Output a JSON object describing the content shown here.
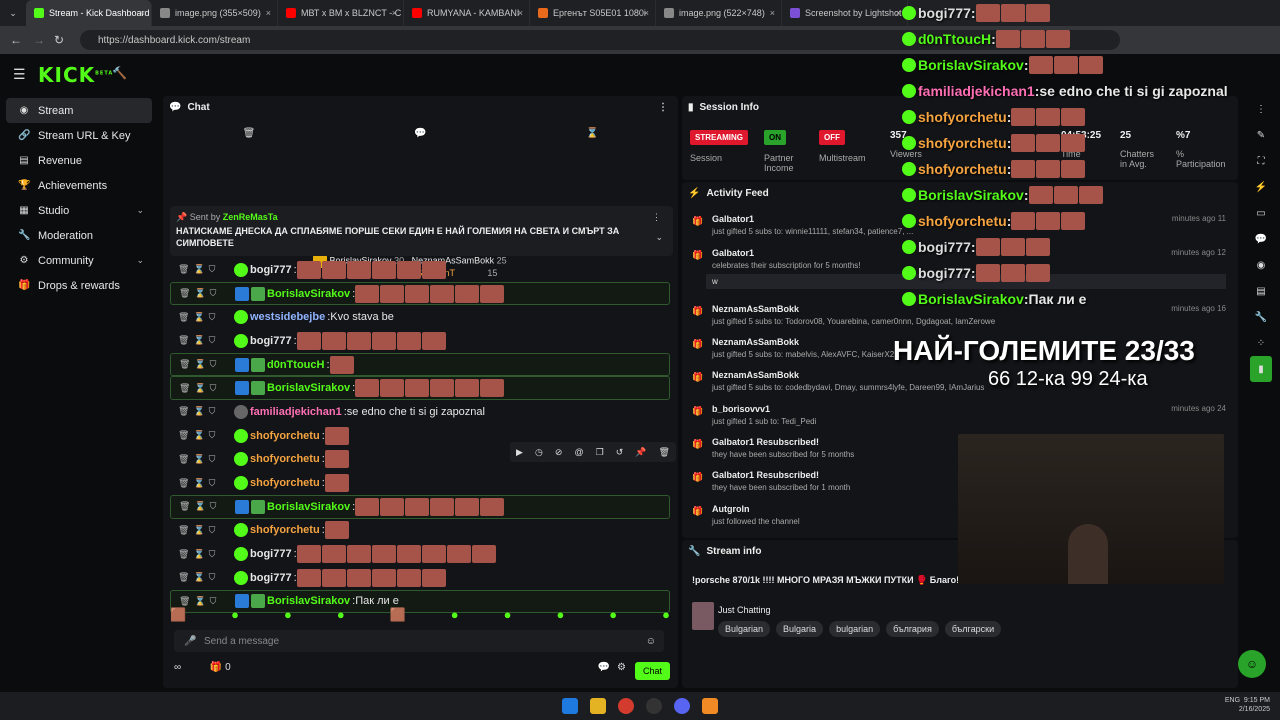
{
  "browser": {
    "tabs": [
      {
        "title": "Stream - Kick Dashboard",
        "color": "#53fc18",
        "active": true
      },
      {
        "title": "image.png (355×509)",
        "color": "#888"
      },
      {
        "title": "МВТ х ВМ х BLZNCT - С",
        "color": "#ff0000"
      },
      {
        "title": "RUMYANA - KAMBANI",
        "color": "#ff0000"
      },
      {
        "title": "Ергенът S05E01 1080i",
        "color": "#e86a1a"
      },
      {
        "title": "image.png (522×748)",
        "color": "#888"
      },
      {
        "title": "Screenshot by Lightshot",
        "color": "#7b4fd6"
      }
    ],
    "url": "https://dashboard.kick.com/stream"
  },
  "brand": {
    "logo": "KICK",
    "beta": "BETA"
  },
  "sidebar": {
    "items": [
      {
        "label": "Stream",
        "icon": "stream-icon",
        "active": true
      },
      {
        "label": "Stream URL & Key",
        "icon": "link-icon"
      },
      {
        "label": "Revenue",
        "icon": "revenue-icon"
      },
      {
        "label": "Achievements",
        "icon": "trophy-icon"
      },
      {
        "label": "Studio",
        "icon": "studio-icon",
        "chevron": true
      },
      {
        "label": "Moderation",
        "icon": "wrench-icon"
      },
      {
        "label": "Community",
        "icon": "community-icon",
        "chevron": true
      },
      {
        "label": "Drops & rewards",
        "icon": "gift-icon"
      }
    ]
  },
  "chat": {
    "title": "Chat",
    "top_gifters": {
      "first": "BorislavSirakov",
      "first_count": "30",
      "second": "NeznamAsSamBokk",
      "second_count": "25",
      "third": "InGentTenT",
      "third_count": "15"
    },
    "pinned": {
      "label": "Sent by",
      "user": "ZenReMasTa",
      "text": "НАТИСКАМЕ ДНЕСКА ДА СПЛАБЯМЕ ПОРШЕ СЕКИ ЕДИН Е НАЙ ГОЛЕМИЯ НА СВЕТА И СМЪРТ ЗА СИМПОВЕТЕ"
    },
    "messages": [
      {
        "user": "bogi777",
        "color": "#e6e6e6",
        "text": "",
        "emotes": 6,
        "hl": false
      },
      {
        "user": "BorislavSirakov",
        "color": "#53fc18",
        "text": "",
        "emotes": 6,
        "hl": true
      },
      {
        "user": "westsidebejbe",
        "color": "#8fb3ff",
        "text": "Kvo stava be",
        "emotes": 0,
        "hl": false
      },
      {
        "user": "bogi777",
        "color": "#e6e6e6",
        "text": "",
        "emotes": 6,
        "hl": false
      },
      {
        "user": "d0nTtoucH",
        "color": "#53fc18",
        "text": "",
        "emotes": 1,
        "hl": true
      },
      {
        "user": "BorislavSirakov",
        "color": "#53fc18",
        "text": "",
        "emotes": 6,
        "hl": true
      },
      {
        "user": "familiadjekichan1",
        "color": "#ff6fb5",
        "text": "se edno che ti si gi zapoznal",
        "emotes": 0,
        "hl": false
      },
      {
        "user": "shofyorchetu",
        "color": "#f4a340",
        "text": "",
        "emotes": 1,
        "hl": false
      },
      {
        "user": "shofyorchetu",
        "color": "#f4a340",
        "text": "",
        "emotes": 1,
        "hl": false
      },
      {
        "user": "shofyorchetu",
        "color": "#f4a340",
        "text": "",
        "emotes": 1,
        "hl": false
      },
      {
        "user": "BorislavSirakov",
        "color": "#53fc18",
        "text": "",
        "emotes": 6,
        "hl": true
      },
      {
        "user": "shofyorchetu",
        "color": "#f4a340",
        "text": "",
        "emotes": 1,
        "hl": false
      },
      {
        "user": "bogi777",
        "color": "#e6e6e6",
        "text": "",
        "emotes": 8,
        "hl": false
      },
      {
        "user": "bogi777",
        "color": "#e6e6e6",
        "text": "",
        "emotes": 6,
        "hl": false
      },
      {
        "user": "BorislavSirakov",
        "color": "#53fc18",
        "text": "Пак ли е",
        "emotes": 0,
        "hl": true
      }
    ],
    "placeholder": "Send a message",
    "count": "0",
    "send_label": "Chat"
  },
  "session": {
    "title": "Session Info",
    "streaming": "STREAMING",
    "on": "ON",
    "off": "OFF",
    "labels": {
      "session": "Session",
      "partner": "Partner Income",
      "multistream": "Multistream",
      "viewers": "Viewers",
      "time": "Time Live",
      "chatters": "Chatters in Avg.",
      "participation": "% Participation"
    },
    "values": {
      "viewers": "357",
      "time": "04:53:25",
      "chatters": "25",
      "participation": "%7"
    }
  },
  "activity": {
    "title": "Activity Feed",
    "items": [
      {
        "who": "Galbator1",
        "det": "just gifted 5 subs to: winnie11111, stefan34, patience7, ...",
        "time": "11 minutes ago"
      },
      {
        "who": "Galbator1",
        "det": "celebrates their subscription for 5 months!",
        "time": "12 minutes ago",
        "note": "w"
      },
      {
        "who": "NeznamAsSamBokk",
        "det": "just gifted 5 subs to: Todorov08, Youarebina, camer0nnn, Dgdagoat, IamZerowe",
        "time": "16 minutes ago"
      },
      {
        "who": "NeznamAsSamBokk",
        "det": "just gifted 5 subs to: mabelvis, AlexAVFC, KaiserX2...",
        "time": ""
      },
      {
        "who": "NeznamAsSamBokk",
        "det": "just gifted 5 subs to: codedbydavi, Dmay, summrs4lyfe, Dareen99, IAmJarius",
        "time": ""
      },
      {
        "who": "b_borisovvv1",
        "det": "just gifted 1 sub to: Tedi_Pedi",
        "time": "24 minutes ago"
      },
      {
        "who": "Galbator1 Resubscribed!",
        "det": "they have been subscribed for 5 months",
        "time": ""
      },
      {
        "who": "Galbator1 Resubscribed!",
        "det": "they have been subscribed for 1 month",
        "time": ""
      },
      {
        "who": "Autgroln",
        "det": "just followed the channel",
        "time": ""
      }
    ]
  },
  "stream_info": {
    "title": "Stream info",
    "stream_title": "!porsche 870/1k !!!! МНОГО МРАЗЯ МЪЖКИ ПУТКИ 🥊 Благо!",
    "category": "Just Chatting",
    "tags": [
      "Bulgarian",
      "Bulgaria",
      "bulgarian",
      "българия",
      "български"
    ]
  },
  "overlay": {
    "lines": [
      {
        "user": "bogi777",
        "text": ""
      },
      {
        "user": "d0nTtoucH",
        "text": ""
      },
      {
        "user": "BorislavSirakov",
        "text": ""
      },
      {
        "user": "familiadjekichan1",
        "text": "se edno che ti si gi zapoznal"
      },
      {
        "user": "shofyorchetu",
        "text": ""
      },
      {
        "user": "shofyorchetu",
        "text": ""
      },
      {
        "user": "shofyorchetu",
        "text": ""
      },
      {
        "user": "BorislavSirakov",
        "text": ""
      },
      {
        "user": "shofyorchetu",
        "text": ""
      },
      {
        "user": "bogi777",
        "text": ""
      },
      {
        "user": "bogi777",
        "text": ""
      },
      {
        "user": "BorislavSirakov",
        "text": "Пак ли е"
      }
    ],
    "headline": "НАЙ-ГОЛЕМИТЕ 23/33",
    "subline": "66 12-ка 99 24-ка"
  },
  "taskbar": {
    "lang": "ENG",
    "time": "9:15 PM",
    "date": "2/16/2025"
  }
}
